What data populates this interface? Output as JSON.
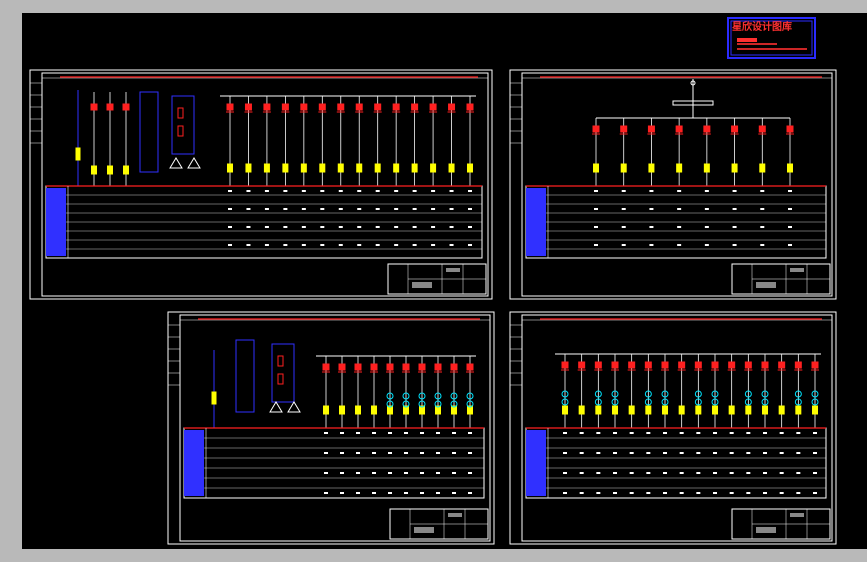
{
  "viewer": {
    "background_color": "#b9b9b9",
    "model_space_color": "#000000"
  },
  "watermark": {
    "title": "星欣设计图库",
    "colors": {
      "frame": "#2b2bff",
      "text": "#ff3030"
    }
  },
  "drawing_colors": {
    "frame": "#ffffff",
    "busbar": "#ff2020",
    "breaker": "#ff2020",
    "cable": "#ffff00",
    "ct": "#00e5ff",
    "panel": "#3030ff",
    "table_header": "#3030ff",
    "text_small": "#ffffff"
  },
  "sheets": [
    {
      "id": "sheet-1",
      "feeders": 14,
      "legend_rows": 8
    },
    {
      "id": "sheet-2",
      "feeders": 8,
      "legend_rows": 8
    },
    {
      "id": "sheet-3",
      "feeders": 10,
      "legend_rows": 7
    },
    {
      "id": "sheet-4",
      "feeders": 16,
      "legend_rows": 7
    }
  ]
}
